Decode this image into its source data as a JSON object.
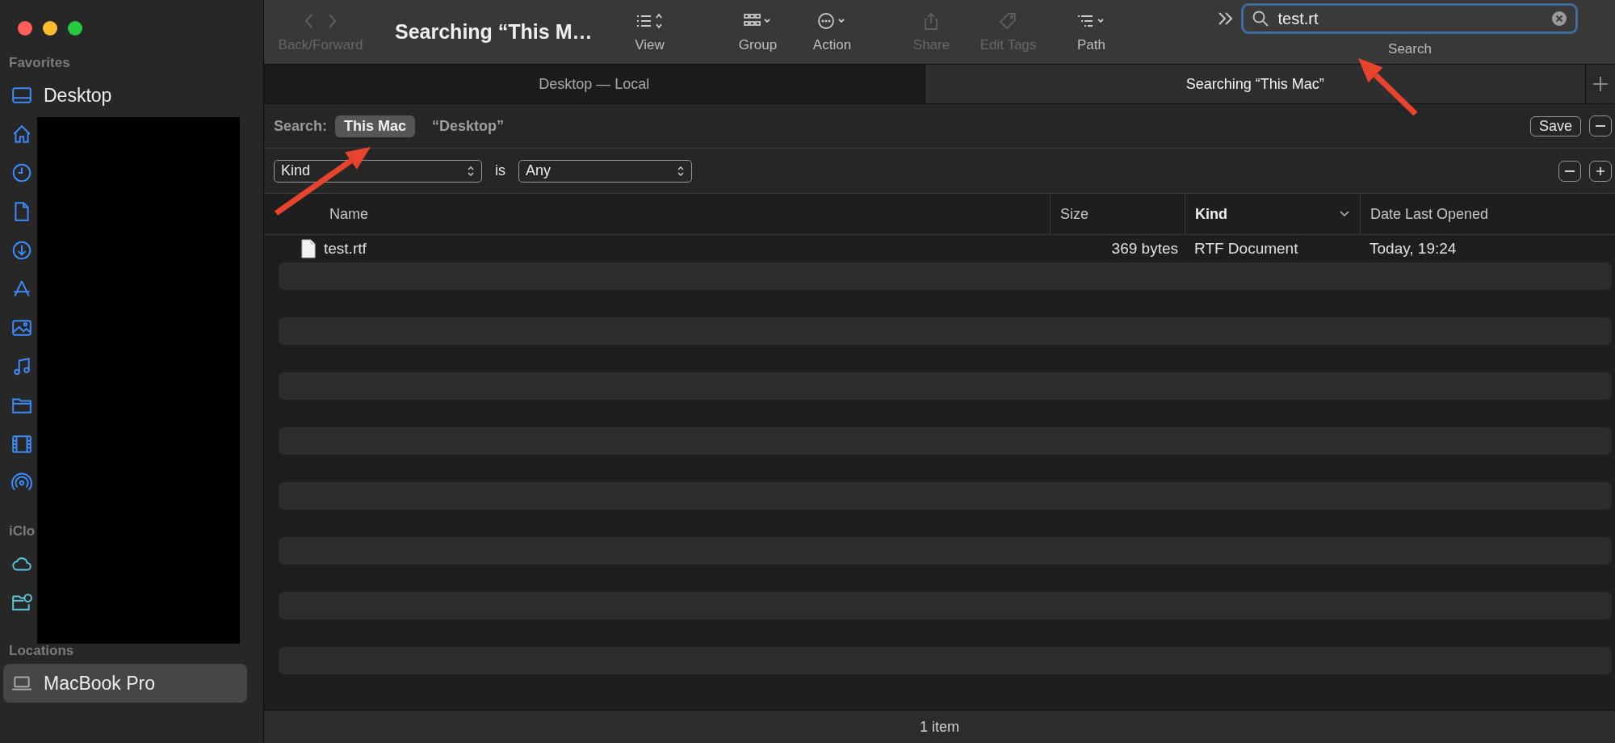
{
  "window": {
    "traffic_lights": [
      {
        "color": "#ff5f57"
      },
      {
        "color": "#febc2e"
      },
      {
        "color": "#28c840"
      }
    ]
  },
  "sidebar": {
    "sections": [
      {
        "title": "Favorites",
        "items": [
          {
            "kind": "desktop",
            "label": "Desktop",
            "selected": false
          },
          {
            "kind": "home",
            "selected": false
          },
          {
            "kind": "clock",
            "selected": false
          },
          {
            "kind": "document",
            "selected": false
          },
          {
            "kind": "download",
            "selected": false
          },
          {
            "kind": "apps",
            "selected": false
          },
          {
            "kind": "photo",
            "selected": false
          },
          {
            "kind": "music",
            "selected": false
          },
          {
            "kind": "folder",
            "selected": false
          },
          {
            "kind": "film",
            "selected": false
          },
          {
            "kind": "airdrop",
            "selected": false
          }
        ]
      },
      {
        "title": "iClo",
        "items": [
          {
            "kind": "cloud",
            "selected": false
          },
          {
            "kind": "shared-folder",
            "selected": false
          }
        ]
      },
      {
        "title": "Locations",
        "items": [
          {
            "kind": "laptop",
            "label": "MacBook Pro",
            "selected": true
          }
        ]
      }
    ]
  },
  "toolbar": {
    "back_forward": {
      "label": "Back/Forward",
      "disabled": true
    },
    "title": "Searching “This M…",
    "items": [
      {
        "kind": "view",
        "label": "View",
        "disabled": false
      },
      {
        "kind": "group",
        "label": "Group",
        "disabled": false
      },
      {
        "kind": "action",
        "label": "Action",
        "disabled": false
      },
      {
        "kind": "share",
        "label": "Share",
        "disabled": true
      },
      {
        "kind": "tags",
        "label": "Edit Tags",
        "disabled": true
      },
      {
        "kind": "path",
        "label": "Path",
        "disabled": false
      }
    ],
    "search": {
      "value": "test.rt",
      "label": "Search"
    }
  },
  "tabs": [
    {
      "label": "Desktop — Local",
      "selected": false
    },
    {
      "label": "Searching “This Mac”",
      "selected": true
    }
  ],
  "search_scope": {
    "label": "Search:",
    "scopes": [
      {
        "label": "This Mac",
        "selected": true
      },
      {
        "label": "“Desktop”",
        "selected": false
      }
    ],
    "save": "Save"
  },
  "criteria": [
    {
      "attribute": "Kind",
      "operator": "is",
      "value": "Any"
    }
  ],
  "table": {
    "columns": [
      {
        "label": "Name",
        "sorted": false
      },
      {
        "label": "Size",
        "sorted": false
      },
      {
        "label": "Kind",
        "sorted": true
      },
      {
        "label": "Date Last Opened",
        "sorted": false
      }
    ],
    "rows": [
      {
        "cells": [
          "test.rtf",
          "369 bytes",
          "RTF Document",
          "Today, 19:24"
        ]
      }
    ]
  },
  "status_bar": {
    "text": "1 item"
  }
}
